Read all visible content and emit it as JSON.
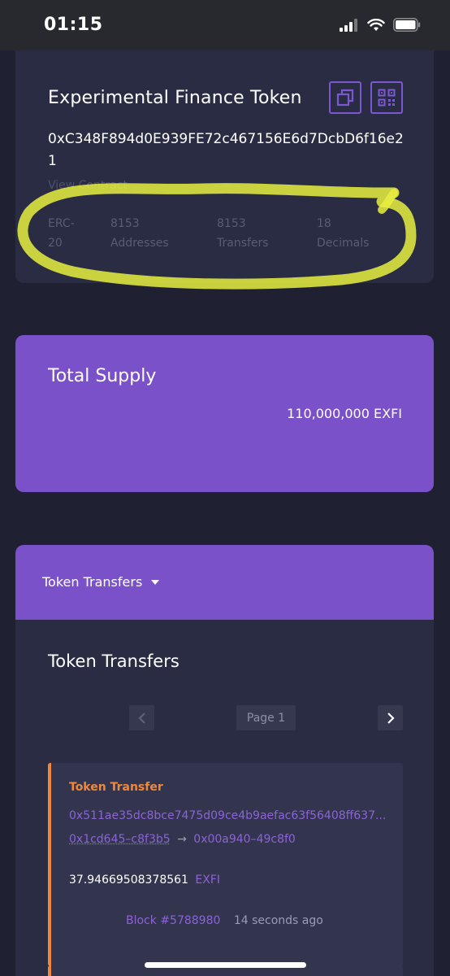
{
  "status_bar": {
    "time": "01:15",
    "icons": [
      "cellular-signal-icon",
      "wifi-icon",
      "battery-icon"
    ]
  },
  "token": {
    "name": "Experimental Finance Token",
    "address": "0xC348F894d0E939FE72c467156E6d7DcbD6f16e21",
    "view_contract_label": "View Contract",
    "stats": [
      {
        "value": "ERC-",
        "label": "20"
      },
      {
        "value": "8153",
        "label": "Addresses"
      },
      {
        "value": "8153",
        "label": "Transfers"
      },
      {
        "value": "18",
        "label": "Decimals"
      }
    ],
    "icons": [
      "copy-icon",
      "qr-code-icon"
    ]
  },
  "supply": {
    "title": "Total Supply",
    "value": "110,000,000 EXFI"
  },
  "transfers": {
    "tab_label": "Token Transfers",
    "title": "Token Transfers",
    "page_label": "Page 1",
    "items": [
      {
        "type": "Token Transfer",
        "hash": "0x511ae35dc8bce7475d09ce4b9aefac63f56408ff637...",
        "from": "0x1cd645–c8f3b5",
        "arrow": "→",
        "to": "0x00a940–49c8f0",
        "amount": "37.94669508378561",
        "symbol": "EXFI",
        "block": "Block #5788980",
        "time": "14 seconds ago"
      }
    ]
  },
  "colors": {
    "background": "#1f2032",
    "card": "#2a2c44",
    "accent_purple": "#7a51c9",
    "link_purple": "#8b63d6",
    "transfer_orange": "#f0883a",
    "highlighter_yellow": "#e8f040"
  }
}
